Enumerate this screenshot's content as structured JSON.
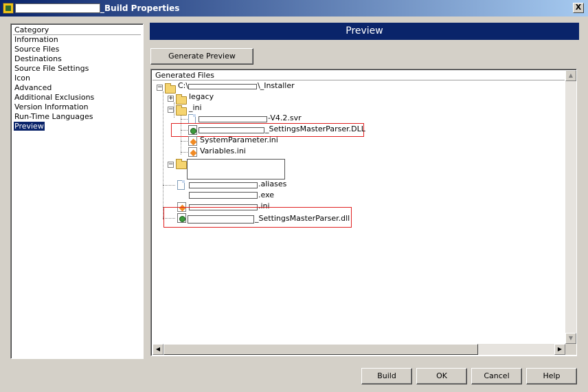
{
  "window": {
    "title": "_Build Properties",
    "close_glyph": "X"
  },
  "category": {
    "header": "Category",
    "items": [
      {
        "label": "Information"
      },
      {
        "label": "Source Files"
      },
      {
        "label": "Destinations"
      },
      {
        "label": "Source File Settings"
      },
      {
        "label": "Icon"
      },
      {
        "label": "Advanced"
      },
      {
        "label": "Additional Exclusions"
      },
      {
        "label": "Version Information"
      },
      {
        "label": "Run-Time Languages"
      },
      {
        "label": "Preview",
        "selected": true
      }
    ]
  },
  "preview": {
    "header": "Preview",
    "generate_button": "Generate Preview",
    "files_header": "Generated Files",
    "tree": {
      "root_prefix": "C:\\",
      "root_suffix": "\\_Installer",
      "legacy": "legacy",
      "ini_folder": "_ini",
      "svr_file": "-V4.2.svr",
      "dll_upper": "_SettingsMasterParser.DLL",
      "system_param": "SystemParameter.ini",
      "variables": "Variables.ini",
      "aliases": ".aliases",
      "exe": ".exe",
      "ini": ".ini",
      "dll_lower": "_SettingsMasterParser.dll"
    }
  },
  "buttons": {
    "build": "Build",
    "ok": "OK",
    "cancel": "Cancel",
    "help": "Help"
  },
  "colors": {
    "accent": "#0a246a",
    "highlight_box": "#e02020"
  },
  "icons": {
    "titlebar": "labview-icon",
    "folder": "folder-icon",
    "file": "file-icon",
    "dll": "dll-icon",
    "ini": "ini-icon"
  }
}
